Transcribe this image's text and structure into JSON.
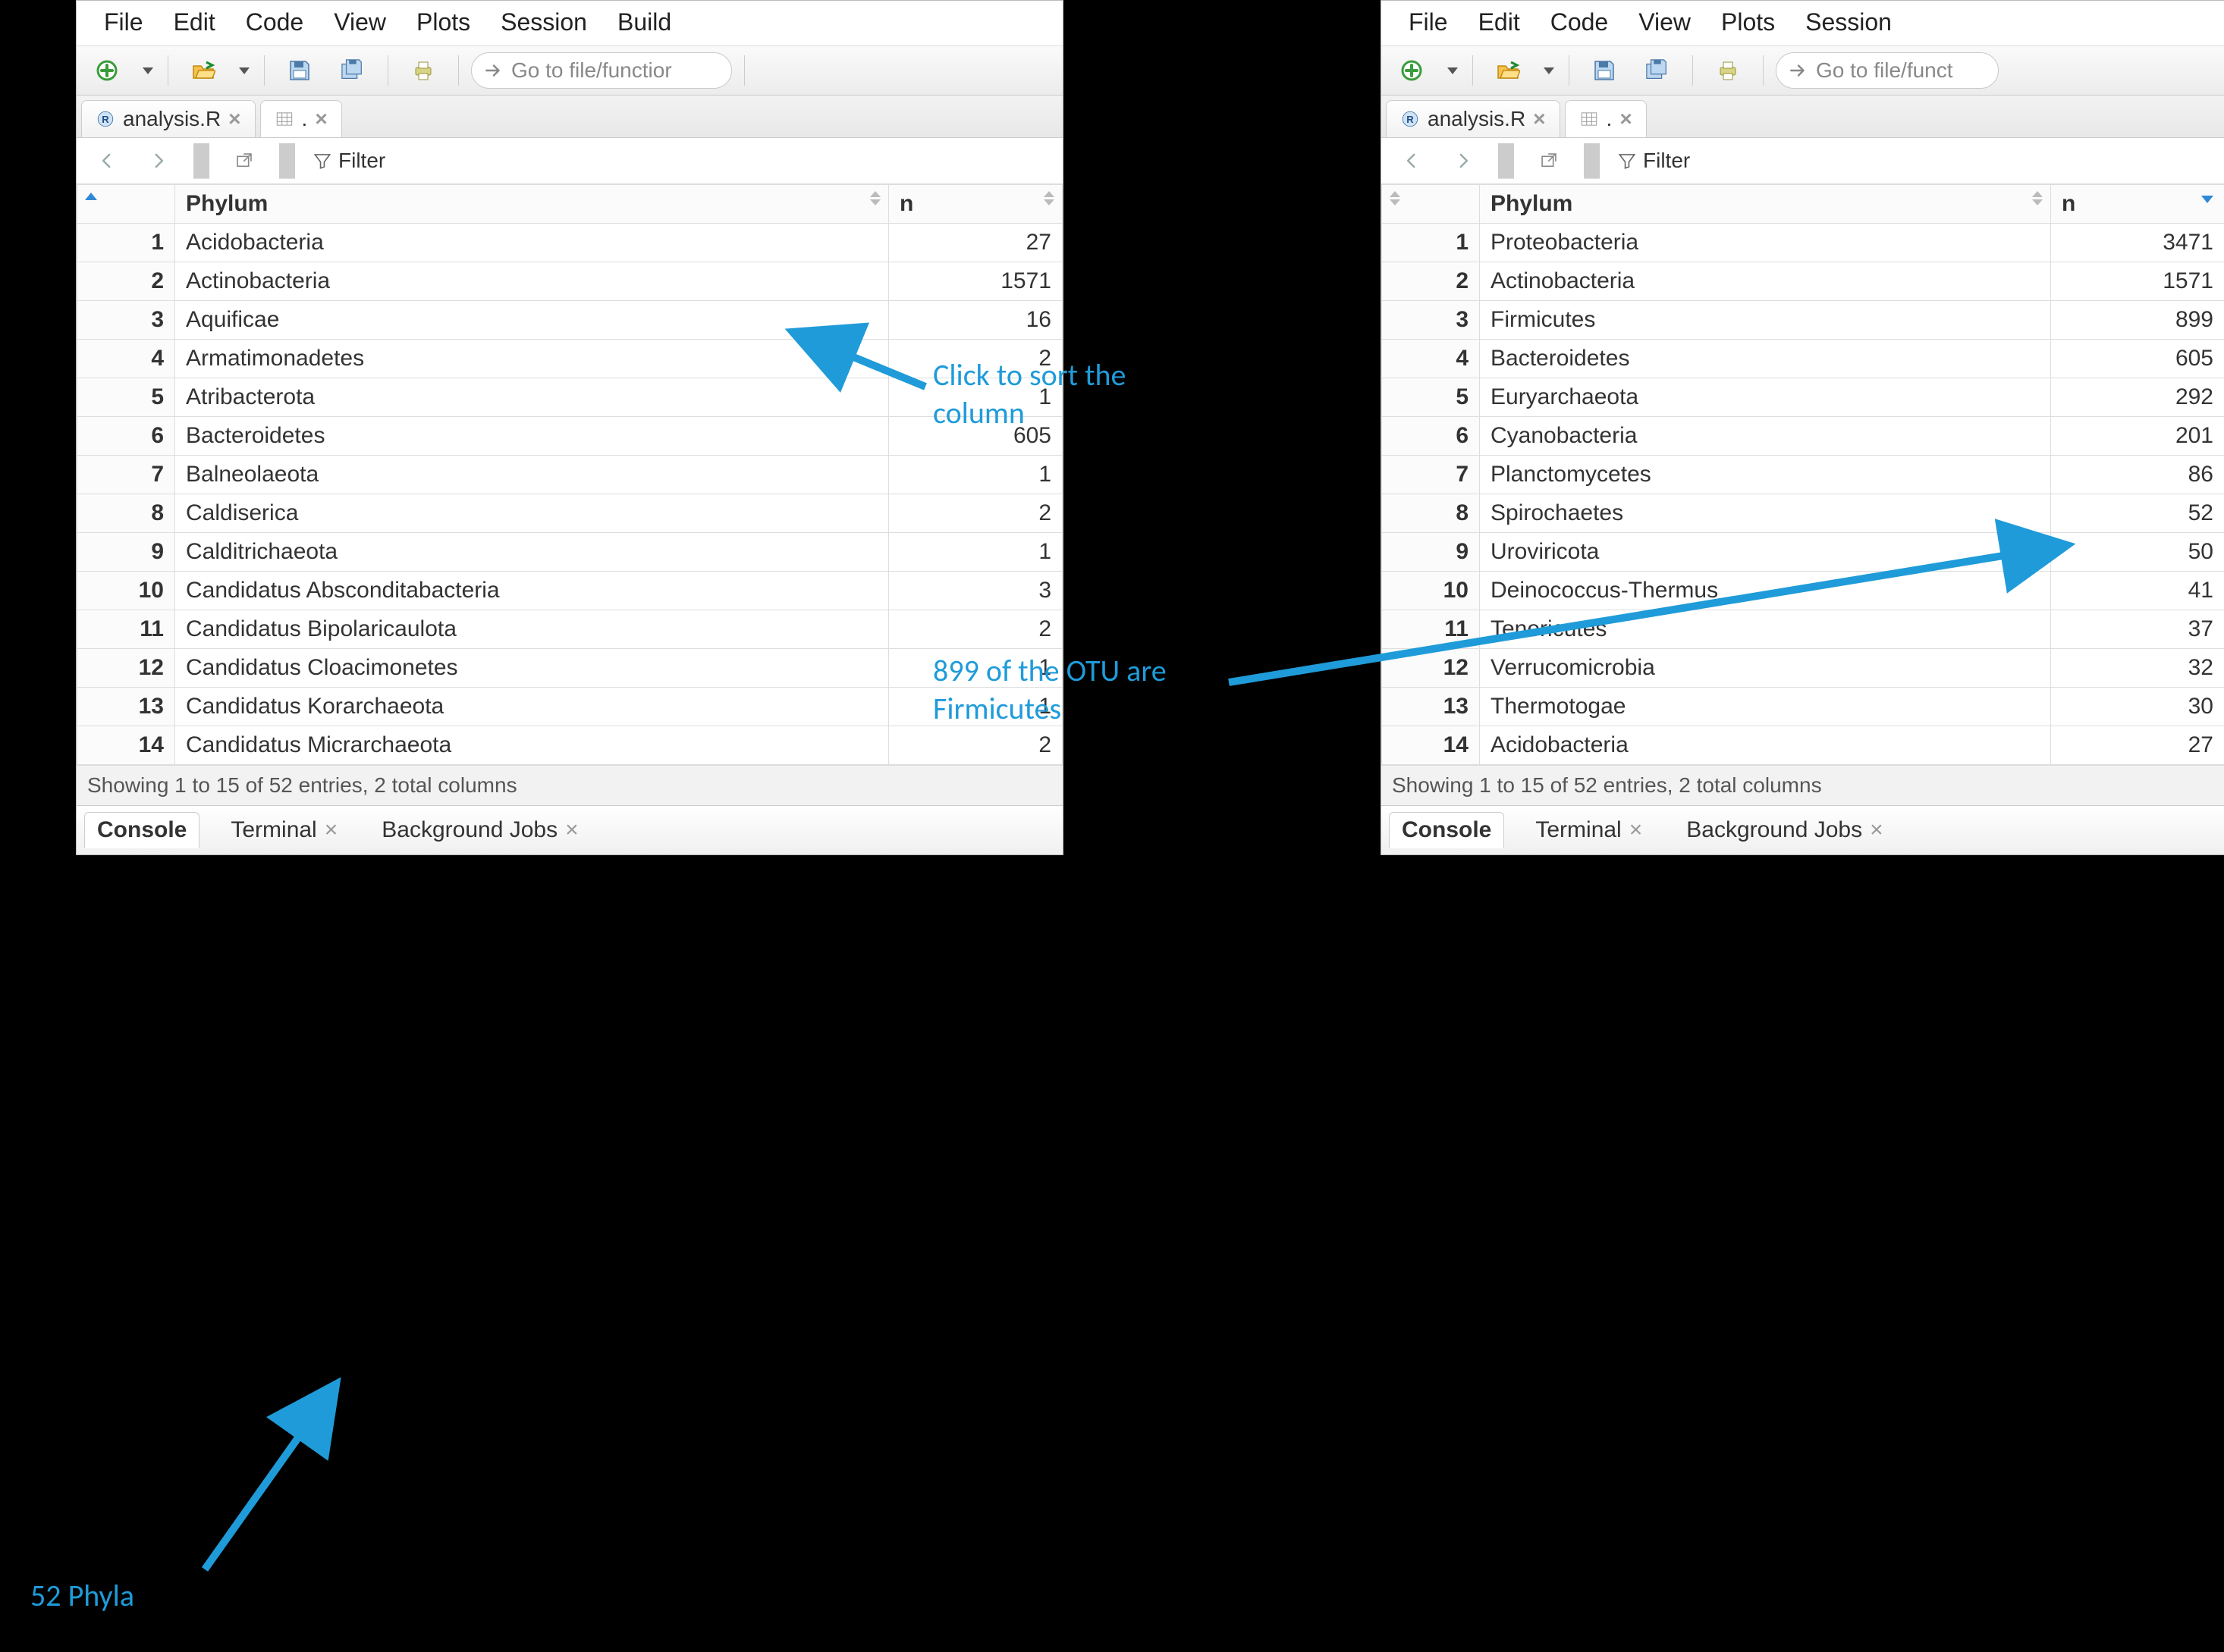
{
  "menu": [
    "File",
    "Edit",
    "Code",
    "View",
    "Plots",
    "Session",
    "Build"
  ],
  "goto_placeholder_left": "Go to file/functior",
  "goto_placeholder_right": "Go to file/funct",
  "tabs": {
    "file": "analysis.R",
    "viewer": "."
  },
  "filter_label": "Filter",
  "columns": {
    "phylum": "Phylum",
    "n": "n"
  },
  "status": "Showing 1 to 15 of 52 entries, 2 total columns",
  "bottom": {
    "console": "Console",
    "terminal": "Terminal",
    "bg": "Background Jobs"
  },
  "left_rows": [
    {
      "i": "1",
      "phylum": "Acidobacteria",
      "n": "27"
    },
    {
      "i": "2",
      "phylum": "Actinobacteria",
      "n": "1571"
    },
    {
      "i": "3",
      "phylum": "Aquificae",
      "n": "16"
    },
    {
      "i": "4",
      "phylum": "Armatimonadetes",
      "n": "2"
    },
    {
      "i": "5",
      "phylum": "Atribacterota",
      "n": "1"
    },
    {
      "i": "6",
      "phylum": "Bacteroidetes",
      "n": "605"
    },
    {
      "i": "7",
      "phylum": "Balneolaeota",
      "n": "1"
    },
    {
      "i": "8",
      "phylum": "Caldiserica",
      "n": "2"
    },
    {
      "i": "9",
      "phylum": "Calditrichaeota",
      "n": "1"
    },
    {
      "i": "10",
      "phylum": "Candidatus Absconditabacteria",
      "n": "3"
    },
    {
      "i": "11",
      "phylum": "Candidatus Bipolaricaulota",
      "n": "2"
    },
    {
      "i": "12",
      "phylum": "Candidatus Cloacimonetes",
      "n": "1"
    },
    {
      "i": "13",
      "phylum": "Candidatus Korarchaeota",
      "n": "1"
    },
    {
      "i": "14",
      "phylum": "Candidatus Micrarchaeota",
      "n": "2"
    }
  ],
  "right_rows": [
    {
      "i": "1",
      "phylum": "Proteobacteria",
      "n": "3471"
    },
    {
      "i": "2",
      "phylum": "Actinobacteria",
      "n": "1571"
    },
    {
      "i": "3",
      "phylum": "Firmicutes",
      "n": "899"
    },
    {
      "i": "4",
      "phylum": "Bacteroidetes",
      "n": "605"
    },
    {
      "i": "5",
      "phylum": "Euryarchaeota",
      "n": "292"
    },
    {
      "i": "6",
      "phylum": "Cyanobacteria",
      "n": "201"
    },
    {
      "i": "7",
      "phylum": "Planctomycetes",
      "n": "86"
    },
    {
      "i": "8",
      "phylum": "Spirochaetes",
      "n": "52"
    },
    {
      "i": "9",
      "phylum": "Uroviricota",
      "n": "50"
    },
    {
      "i": "10",
      "phylum": "Deinococcus-Thermus",
      "n": "41"
    },
    {
      "i": "11",
      "phylum": "Tenericutes",
      "n": "37"
    },
    {
      "i": "12",
      "phylum": "Verrucomicrobia",
      "n": "32"
    },
    {
      "i": "13",
      "phylum": "Thermotogae",
      "n": "30"
    },
    {
      "i": "14",
      "phylum": "Acidobacteria",
      "n": "27"
    }
  ],
  "annotations": {
    "click_sort": "Click to sort the column",
    "firmicutes": "899 of the OTU are Firmicutes",
    "phyla": "52 Phyla"
  }
}
